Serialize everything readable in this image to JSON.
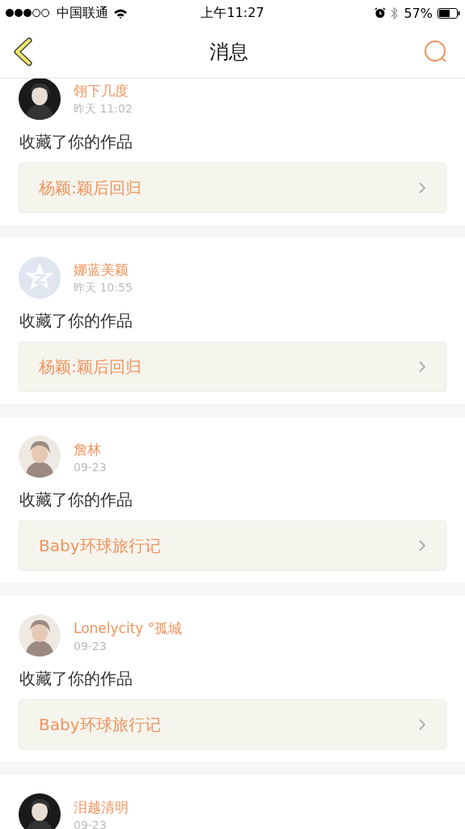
{
  "status_bar": {
    "carrier": "中国联通",
    "time": "上午11:27",
    "battery": "57%"
  },
  "nav": {
    "title": "消息"
  },
  "messages": [
    {
      "user": "翎下几度",
      "time": "昨天 11:02",
      "action": "收藏了你的作品",
      "work": "杨颖:颖后回归"
    },
    {
      "user": "娜蓝美颖",
      "time": "昨天 10:55",
      "avatar": {
        "kind": "default"
      },
      "action": "收藏了你的作品",
      "work": "杨颖:颖后回归"
    },
    {
      "user": "詹林",
      "time": "09-23",
      "action": "收藏了你的作品",
      "work": "Baby环球旅行记"
    },
    {
      "user": "Lonelycity °孤城",
      "time": "09-23",
      "action": "收藏了你的作品",
      "work": "Baby环球旅行记"
    },
    {
      "user": "泪越清明",
      "time": "09-23"
    }
  ]
}
